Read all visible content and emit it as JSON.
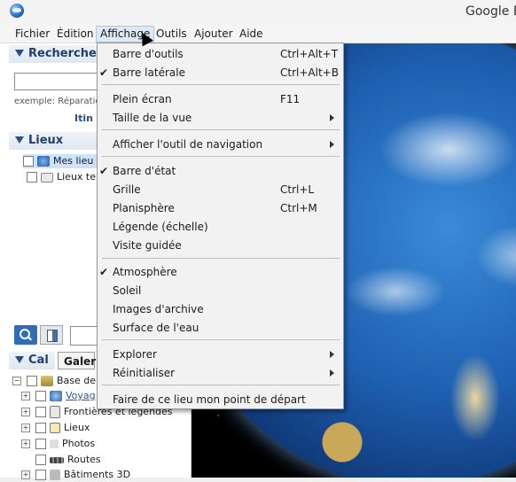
{
  "window": {
    "title": "Google E"
  },
  "menubar": {
    "items": [
      "Fichier",
      "Édition",
      "Affichage",
      "Outils",
      "Ajouter",
      "Aide"
    ]
  },
  "sidebar": {
    "search": {
      "header": "Recherche",
      "example": "exemple: Réparatio",
      "link": "Itin"
    },
    "places": {
      "header": "Lieux",
      "items": [
        {
          "label": "Mes lieu",
          "selected": true
        },
        {
          "label": "Lieux te",
          "selected": false
        }
      ]
    },
    "layers": {
      "header": "Cal",
      "gallery_button": "Galeri",
      "items": [
        {
          "label": "Base de"
        },
        {
          "label": "Voyag"
        },
        {
          "label": "Frontières et légendes"
        },
        {
          "label": "Lieux"
        },
        {
          "label": "Photos"
        },
        {
          "label": "Routes"
        },
        {
          "label": "Bâtiments 3D"
        }
      ]
    }
  },
  "dropdown": {
    "items": [
      {
        "label": "Barre d'outils",
        "shortcut": "Ctrl+Alt+T",
        "checked": false
      },
      {
        "label": "Barre latérale",
        "shortcut": "Ctrl+Alt+B",
        "checked": true
      },
      {
        "label": "Plein écran",
        "shortcut": "F11",
        "checked": false
      },
      {
        "label": "Taille de la vue",
        "submenu": true
      },
      {
        "label": "Afficher l'outil de navigation",
        "submenu": true
      },
      {
        "label": "Barre d'état",
        "checked": true
      },
      {
        "label": "Grille",
        "shortcut": "Ctrl+L"
      },
      {
        "label": "Planisphère",
        "shortcut": "Ctrl+M"
      },
      {
        "label": "Légende (échelle)"
      },
      {
        "label": "Visite guidée"
      },
      {
        "label": "Atmosphère",
        "checked": true
      },
      {
        "label": "Soleil"
      },
      {
        "label": "Images d'archive"
      },
      {
        "label": "Surface de l'eau"
      },
      {
        "label": "Explorer",
        "submenu": true
      },
      {
        "label": "Réinitialiser",
        "submenu": true
      },
      {
        "label": "Faire de ce lieu mon point de départ"
      }
    ],
    "check_glyph": "✔"
  },
  "colors": {
    "menu_open_bg": "#dde9f7",
    "panel_header": "#1f3f6e",
    "selection": "#cde3fb"
  }
}
